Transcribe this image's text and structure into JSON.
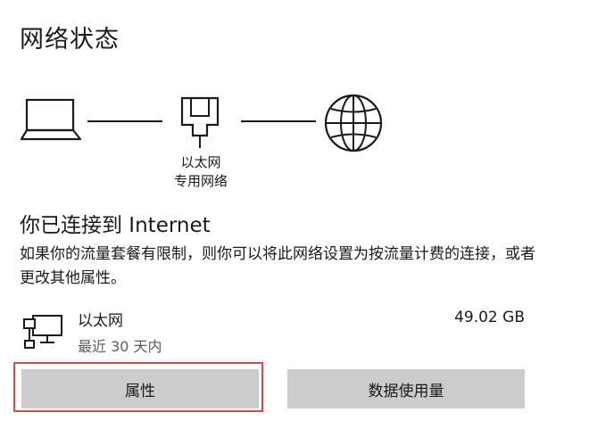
{
  "title": "网络状态",
  "diagram": {
    "computer_icon": "laptop-icon",
    "adapter_icon": "ethernet-icon",
    "internet_icon": "globe-icon",
    "adapter_label_line1": "以太网",
    "adapter_label_line2": "专用网络"
  },
  "status": {
    "heading": "你已连接到 Internet",
    "description": "如果你的流量套餐有限制，则你可以将此网络设置为按流量计费的连接，或者更改其他属性。"
  },
  "connection": {
    "icon": "wired-network-icon",
    "name": "以太网",
    "period": "最近 30 天内",
    "usage": "49.02 GB"
  },
  "buttons": {
    "properties": "属性",
    "data_usage": "数据使用量"
  },
  "colors": {
    "button_bg": "#cccccc",
    "highlight": "#d24a4a",
    "secondary_text": "#5c5c5c"
  }
}
